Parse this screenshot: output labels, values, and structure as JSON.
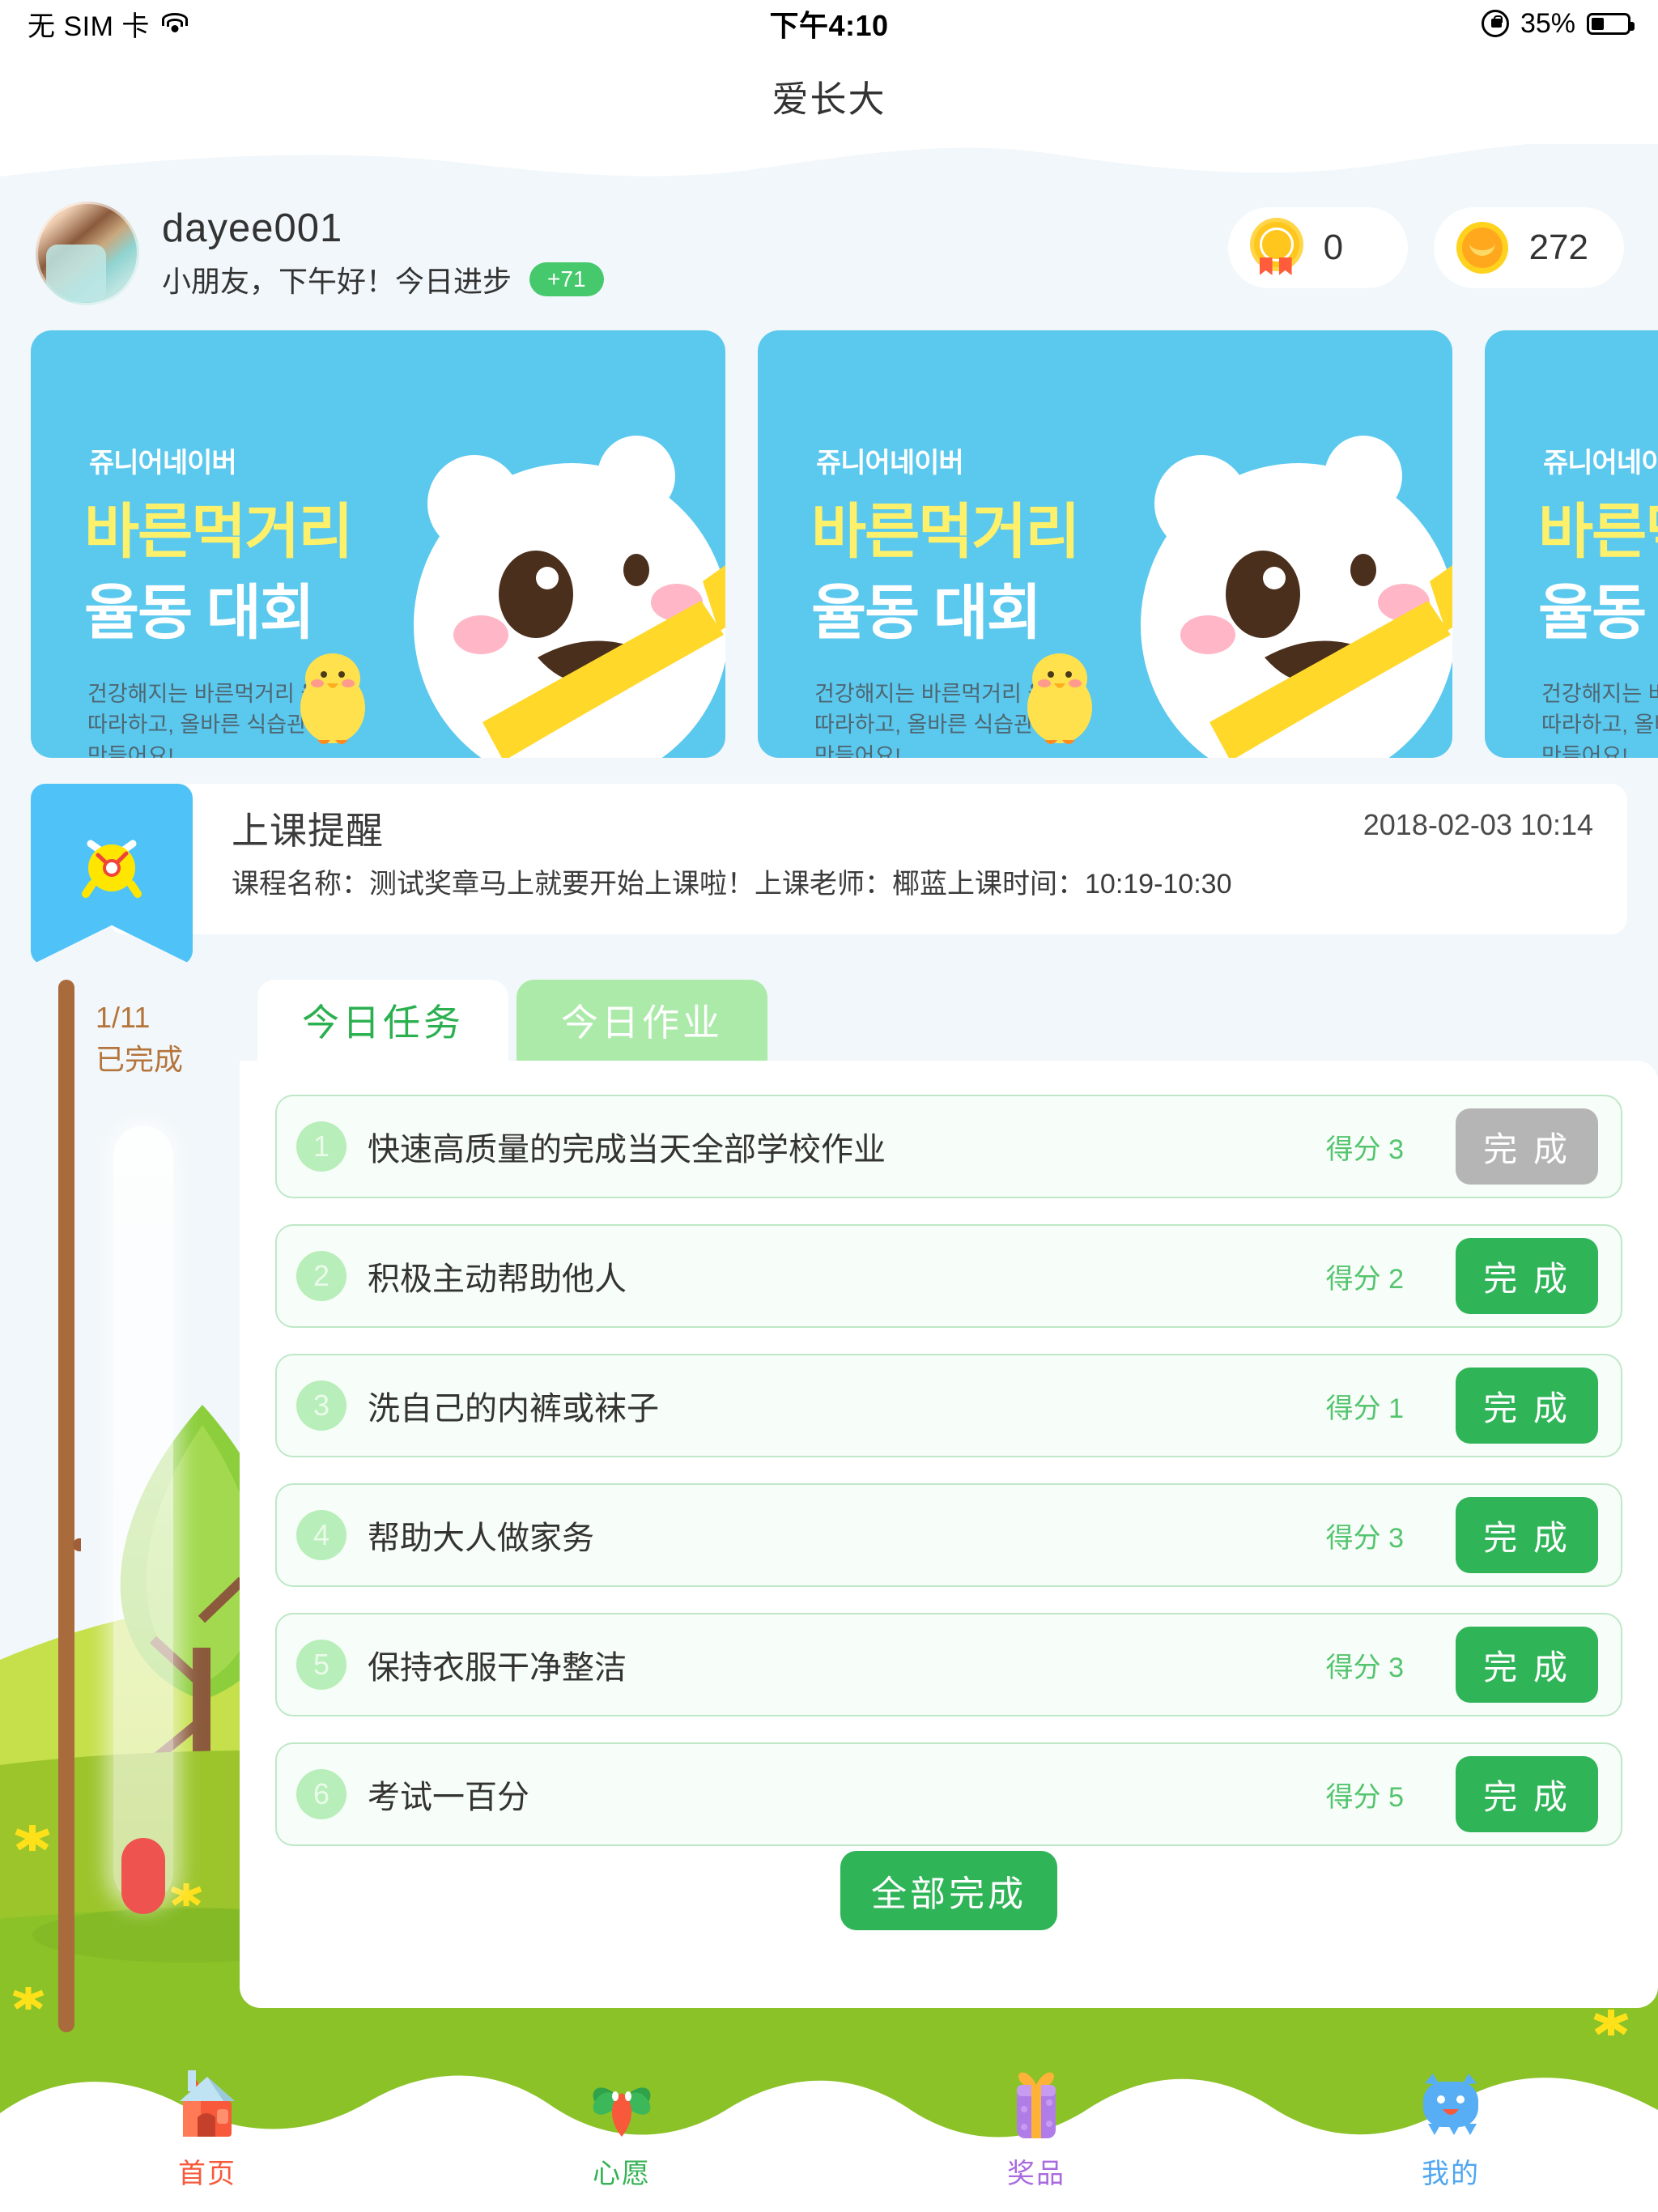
{
  "status_bar": {
    "carrier": "无 SIM 卡",
    "wifi_icon": "wifi-icon",
    "time": "下午4:10",
    "orientation_lock_icon": "rotation-lock-icon",
    "battery_percent": "35%",
    "battery_icon": "battery-icon"
  },
  "header": {
    "title": "爱长大"
  },
  "profile": {
    "avatar_icon": "user-avatar",
    "username": "dayee001",
    "greeting": "小朋友，下午好！今日进步",
    "progress_badge": "+71",
    "scores": [
      {
        "icon": "medal-icon",
        "value": "0"
      },
      {
        "icon": "coin-icon",
        "value": "272"
      }
    ]
  },
  "banners": [
    {
      "brand": "쥬니어네이버",
      "title_line1": "바른먹거리",
      "title_line2": "율동 대회",
      "subtitle": "건강해지는 바른먹거리 율동\n따라하고, 올바른 식습관\n만들어요!",
      "bg_color": "#5bc8ee"
    },
    {
      "brand": "쥬니어네이버",
      "title_line1": "바른먹거리",
      "title_line2": "율동 대회",
      "subtitle": "건강해지는 바른먹거리 율동\n따라하고, 올바른 식습관\n만들어요!",
      "bg_color": "#5bc8ee"
    },
    {
      "brand": "쥬니어네이버",
      "title_line1": "바른먹거리",
      "title_line2": "율동 대회",
      "subtitle": "건강해지는 바른먹거리 율동\n따라하고, 올바른 식습관\n만들어요!",
      "bg_color": "#5bc8ee"
    }
  ],
  "reminder": {
    "icon": "alarm-clock-icon",
    "title": "上课提醒",
    "date": "2018-02-03 10:14",
    "description": "课程名称：测试奖章马上就要开始上课啦！上课老师：椰蓝上课时间：10:19-10:30"
  },
  "thermometer": {
    "count_label": "1/11",
    "status_label": "已完成",
    "fill_color": "#ef5350",
    "text_color": "#b5743a"
  },
  "tabs": [
    {
      "label": "今日任务",
      "active": true
    },
    {
      "label": "今日作业",
      "active": false
    }
  ],
  "tasks": [
    {
      "num": "1",
      "title": "快速高质量的完成当天全部学校作业",
      "score": "得分 3",
      "button": "完 成",
      "state": "disabled"
    },
    {
      "num": "2",
      "title": "积极主动帮助他人",
      "score": "得分 2",
      "button": "完 成",
      "state": "enabled"
    },
    {
      "num": "3",
      "title": "洗自己的内裤或袜子",
      "score": "得分 1",
      "button": "完 成",
      "state": "enabled"
    },
    {
      "num": "4",
      "title": "帮助大人做家务",
      "score": "得分 3",
      "button": "完 成",
      "state": "enabled"
    },
    {
      "num": "5",
      "title": "保持衣服干净整洁",
      "score": "得分 3",
      "button": "完 成",
      "state": "enabled"
    },
    {
      "num": "6",
      "title": "考试一百分",
      "score": "得分 5",
      "button": "完 成",
      "state": "enabled"
    }
  ],
  "complete_all_button": "全部完成",
  "bottom_nav": [
    {
      "icon": "home-icon",
      "label": "首页",
      "color": "#f8593a",
      "active": true
    },
    {
      "icon": "clover-icon",
      "label": "心愿",
      "color": "#34b254",
      "active": false
    },
    {
      "icon": "gift-icon",
      "label": "奖品",
      "color": "#a96ae0",
      "active": false
    },
    {
      "icon": "profile-monster-icon",
      "label": "我的",
      "color": "#4ea6f2",
      "active": false
    }
  ],
  "theme": {
    "page_bg": "#f1f7fa",
    "accent_green": "#2fb457",
    "banner_blue": "#5bc8ee",
    "grass_green": "#8bc228"
  }
}
